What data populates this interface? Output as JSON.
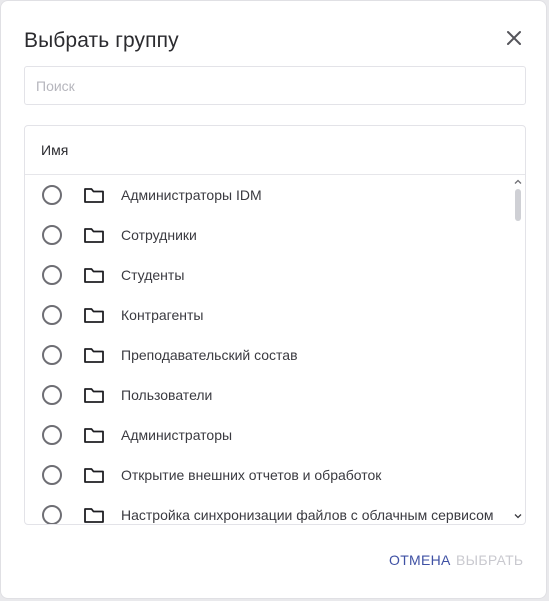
{
  "dialog": {
    "title": "Выбрать группу",
    "close_icon": "close-icon"
  },
  "search": {
    "placeholder": "Поиск",
    "value": ""
  },
  "table": {
    "column_header": "Имя",
    "rows": [
      {
        "label": "Администраторы IDM",
        "selected": false,
        "icon": "folder-icon"
      },
      {
        "label": "Сотрудники",
        "selected": false,
        "icon": "folder-icon"
      },
      {
        "label": "Студенты",
        "selected": false,
        "icon": "folder-icon"
      },
      {
        "label": "Контрагенты",
        "selected": false,
        "icon": "folder-icon"
      },
      {
        "label": "Преподавательский состав",
        "selected": false,
        "icon": "folder-icon"
      },
      {
        "label": "Пользователи",
        "selected": false,
        "icon": "folder-icon"
      },
      {
        "label": "Администраторы",
        "selected": false,
        "icon": "folder-icon"
      },
      {
        "label": "Открытие внешних отчетов и обработок",
        "selected": false,
        "icon": "folder-icon"
      },
      {
        "label": "Настройка синхронизации файлов с облачным сервисом",
        "selected": false,
        "icon": "folder-icon"
      }
    ]
  },
  "footer": {
    "cancel_label": "Отмена",
    "select_label": "Выбрать",
    "select_enabled": false
  },
  "colors": {
    "accent": "#3f51a4",
    "disabled": "#c9c9cf",
    "text": "#2b2b2f",
    "border": "#e3e3e8"
  }
}
